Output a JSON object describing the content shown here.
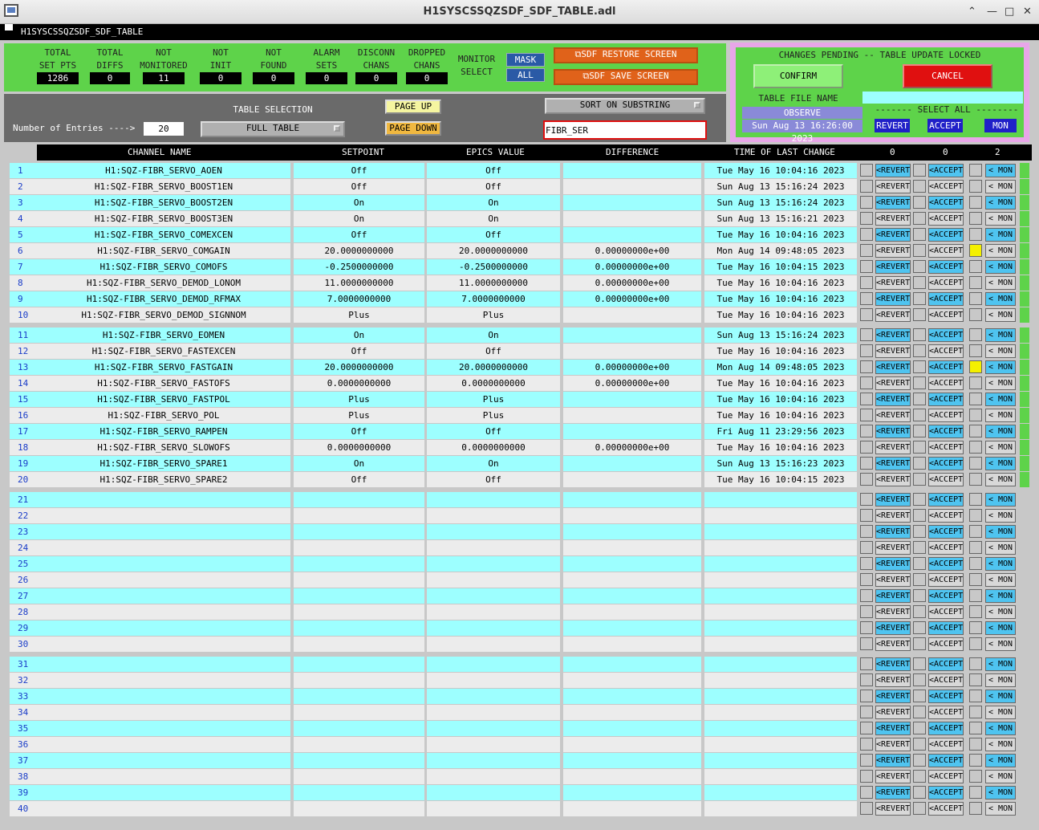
{
  "window": {
    "title": "H1SYSCSSQZSDF_SDF_TABLE.adl",
    "menu_label": "H1SYSCSSQZSDF_SDF_TABLE"
  },
  "stats": [
    {
      "label1": "TOTAL",
      "label2": "SET PTS",
      "value": "1286"
    },
    {
      "label1": "TOTAL",
      "label2": "DIFFS",
      "value": "0"
    },
    {
      "label1": "NOT",
      "label2": "MONITORED",
      "value": "11"
    },
    {
      "label1": "NOT",
      "label2": "INIT",
      "value": "0"
    },
    {
      "label1": "NOT",
      "label2": "FOUND",
      "value": "0"
    },
    {
      "label1": "ALARM",
      "label2": "SETS",
      "value": "0"
    },
    {
      "label1": "DISCONN",
      "label2": "CHANS",
      "value": "0"
    },
    {
      "label1": "DROPPED",
      "label2": "CHANS",
      "value": "0"
    }
  ],
  "monitor": {
    "label1": "MONITOR",
    "label2": "SELECT",
    "mask": "MASK",
    "all": "ALL"
  },
  "sdf": {
    "restore": "⧉SDF RESTORE SCREEN",
    "save": "⧉SDF SAVE SCREEN"
  },
  "pending": {
    "title": "CHANGES PENDING -- TABLE UPDATE LOCKED",
    "confirm": "CONFIRM",
    "cancel": "CANCEL",
    "file_label": "TABLE FILE NAME",
    "file_value": "",
    "observe": "OBSERVE",
    "date": "Sun Aug 13 16:26:00 2023",
    "select_all": "------- SELECT ALL --------",
    "revert": "REVERT",
    "accept": "ACCEPT",
    "mon": "MON"
  },
  "controls": {
    "table_selection": "TABLE SELECTION",
    "entries_label": "Number of Entries ---->",
    "entries": "20",
    "full_table": "FULL TABLE",
    "page_up": "PAGE UP",
    "page_down": "PAGE DOWN",
    "sort": "SORT ON SUBSTRING",
    "filter": "FIBR_SER"
  },
  "headers": {
    "channel": "CHANNEL NAME",
    "setpoint": "SETPOINT",
    "epics": "EPICS VALUE",
    "diff": "DIFFERENCE",
    "time": "TIME OF LAST CHANGE",
    "c1": "0",
    "c2": "0",
    "c3": "2"
  },
  "row_buttons": {
    "revert": "<REVERT",
    "accept": "<ACCEPT",
    "mon": "< MON"
  },
  "rows": [
    {
      "n": "1",
      "name": "H1:SQZ-FIBR_SERVO_AOEN",
      "sp": "Off",
      "ev": "Off",
      "diff": "",
      "time": "Tue May 16 10:04:16 2023",
      "mark": false
    },
    {
      "n": "2",
      "name": "H1:SQZ-FIBR_SERVO_BOOST1EN",
      "sp": "Off",
      "ev": "Off",
      "diff": "",
      "time": "Sun Aug 13 15:16:24 2023",
      "mark": false
    },
    {
      "n": "3",
      "name": "H1:SQZ-FIBR_SERVO_BOOST2EN",
      "sp": "On",
      "ev": "On",
      "diff": "",
      "time": "Sun Aug 13 15:16:24 2023",
      "mark": false
    },
    {
      "n": "4",
      "name": "H1:SQZ-FIBR_SERVO_BOOST3EN",
      "sp": "On",
      "ev": "On",
      "diff": "",
      "time": "Sun Aug 13 15:16:21 2023",
      "mark": false
    },
    {
      "n": "5",
      "name": "H1:SQZ-FIBR_SERVO_COMEXCEN",
      "sp": "Off",
      "ev": "Off",
      "diff": "",
      "time": "Tue May 16 10:04:16 2023",
      "mark": false
    },
    {
      "n": "6",
      "name": "H1:SQZ-FIBR_SERVO_COMGAIN",
      "sp": "20.0000000000",
      "ev": "20.0000000000",
      "diff": "0.00000000e+00",
      "time": "Mon Aug 14 09:48:05 2023",
      "mark": true
    },
    {
      "n": "7",
      "name": "H1:SQZ-FIBR_SERVO_COMOFS",
      "sp": "-0.2500000000",
      "ev": "-0.2500000000",
      "diff": "0.00000000e+00",
      "time": "Tue May 16 10:04:15 2023",
      "mark": false
    },
    {
      "n": "8",
      "name": "H1:SQZ-FIBR_SERVO_DEMOD_LONOM",
      "sp": "11.0000000000",
      "ev": "11.0000000000",
      "diff": "0.00000000e+00",
      "time": "Tue May 16 10:04:16 2023",
      "mark": false
    },
    {
      "n": "9",
      "name": "H1:SQZ-FIBR_SERVO_DEMOD_RFMAX",
      "sp": "7.0000000000",
      "ev": "7.0000000000",
      "diff": "0.00000000e+00",
      "time": "Tue May 16 10:04:16 2023",
      "mark": false
    },
    {
      "n": "10",
      "name": "H1:SQZ-FIBR_SERVO_DEMOD_SIGNNOM",
      "sp": "Plus",
      "ev": "Plus",
      "diff": "",
      "time": "Tue May 16 10:04:16 2023",
      "mark": false
    },
    {
      "n": "11",
      "name": "H1:SQZ-FIBR_SERVO_EOMEN",
      "sp": "On",
      "ev": "On",
      "diff": "",
      "time": "Sun Aug 13 15:16:24 2023",
      "mark": false
    },
    {
      "n": "12",
      "name": "H1:SQZ-FIBR_SERVO_FASTEXCEN",
      "sp": "Off",
      "ev": "Off",
      "diff": "",
      "time": "Tue May 16 10:04:16 2023",
      "mark": false
    },
    {
      "n": "13",
      "name": "H1:SQZ-FIBR_SERVO_FASTGAIN",
      "sp": "20.0000000000",
      "ev": "20.0000000000",
      "diff": "0.00000000e+00",
      "time": "Mon Aug 14 09:48:05 2023",
      "mark": true
    },
    {
      "n": "14",
      "name": "H1:SQZ-FIBR_SERVO_FASTOFS",
      "sp": "0.0000000000",
      "ev": "0.0000000000",
      "diff": "0.00000000e+00",
      "time": "Tue May 16 10:04:16 2023",
      "mark": false
    },
    {
      "n": "15",
      "name": "H1:SQZ-FIBR_SERVO_FASTPOL",
      "sp": "Plus",
      "ev": "Plus",
      "diff": "",
      "time": "Tue May 16 10:04:16 2023",
      "mark": false
    },
    {
      "n": "16",
      "name": "H1:SQZ-FIBR_SERVO_POL",
      "sp": "Plus",
      "ev": "Plus",
      "diff": "",
      "time": "Tue May 16 10:04:16 2023",
      "mark": false
    },
    {
      "n": "17",
      "name": "H1:SQZ-FIBR_SERVO_RAMPEN",
      "sp": "Off",
      "ev": "Off",
      "diff": "",
      "time": "Fri Aug 11 23:29:56 2023",
      "mark": false
    },
    {
      "n": "18",
      "name": "H1:SQZ-FIBR_SERVO_SLOWOFS",
      "sp": "0.0000000000",
      "ev": "0.0000000000",
      "diff": "0.00000000e+00",
      "time": "Tue May 16 10:04:16 2023",
      "mark": false
    },
    {
      "n": "19",
      "name": "H1:SQZ-FIBR_SERVO_SPARE1",
      "sp": "On",
      "ev": "On",
      "diff": "",
      "time": "Sun Aug 13 15:16:23 2023",
      "mark": false
    },
    {
      "n": "20",
      "name": "H1:SQZ-FIBR_SERVO_SPARE2",
      "sp": "Off",
      "ev": "Off",
      "diff": "",
      "time": "Tue May 16 10:04:15 2023",
      "mark": false
    },
    {
      "n": "21",
      "name": "",
      "sp": "",
      "ev": "",
      "diff": "",
      "time": "",
      "mark": false
    },
    {
      "n": "22",
      "name": "",
      "sp": "",
      "ev": "",
      "diff": "",
      "time": "",
      "mark": false
    },
    {
      "n": "23",
      "name": "",
      "sp": "",
      "ev": "",
      "diff": "",
      "time": "",
      "mark": false
    },
    {
      "n": "24",
      "name": "",
      "sp": "",
      "ev": "",
      "diff": "",
      "time": "",
      "mark": false
    },
    {
      "n": "25",
      "name": "",
      "sp": "",
      "ev": "",
      "diff": "",
      "time": "",
      "mark": false
    },
    {
      "n": "26",
      "name": "",
      "sp": "",
      "ev": "",
      "diff": "",
      "time": "",
      "mark": false
    },
    {
      "n": "27",
      "name": "",
      "sp": "",
      "ev": "",
      "diff": "",
      "time": "",
      "mark": false
    },
    {
      "n": "28",
      "name": "",
      "sp": "",
      "ev": "",
      "diff": "",
      "time": "",
      "mark": false
    },
    {
      "n": "29",
      "name": "",
      "sp": "",
      "ev": "",
      "diff": "",
      "time": "",
      "mark": false
    },
    {
      "n": "30",
      "name": "",
      "sp": "",
      "ev": "",
      "diff": "",
      "time": "",
      "mark": false
    },
    {
      "n": "31",
      "name": "",
      "sp": "",
      "ev": "",
      "diff": "",
      "time": "",
      "mark": false
    },
    {
      "n": "32",
      "name": "",
      "sp": "",
      "ev": "",
      "diff": "",
      "time": "",
      "mark": false
    },
    {
      "n": "33",
      "name": "",
      "sp": "",
      "ev": "",
      "diff": "",
      "time": "",
      "mark": false
    },
    {
      "n": "34",
      "name": "",
      "sp": "",
      "ev": "",
      "diff": "",
      "time": "",
      "mark": false
    },
    {
      "n": "35",
      "name": "",
      "sp": "",
      "ev": "",
      "diff": "",
      "time": "",
      "mark": false
    },
    {
      "n": "36",
      "name": "",
      "sp": "",
      "ev": "",
      "diff": "",
      "time": "",
      "mark": false
    },
    {
      "n": "37",
      "name": "",
      "sp": "",
      "ev": "",
      "diff": "",
      "time": "",
      "mark": false
    },
    {
      "n": "38",
      "name": "",
      "sp": "",
      "ev": "",
      "diff": "",
      "time": "",
      "mark": false
    },
    {
      "n": "39",
      "name": "",
      "sp": "",
      "ev": "",
      "diff": "",
      "time": "",
      "mark": false
    },
    {
      "n": "40",
      "name": "",
      "sp": "",
      "ev": "",
      "diff": "",
      "time": "",
      "mark": false
    }
  ],
  "colors": {
    "cyan": "#9dffff",
    "light": "#ececec",
    "green": "#5ed34a",
    "btn_cyan": "#4fc4f0",
    "btn_light": "#d8d8d8"
  }
}
